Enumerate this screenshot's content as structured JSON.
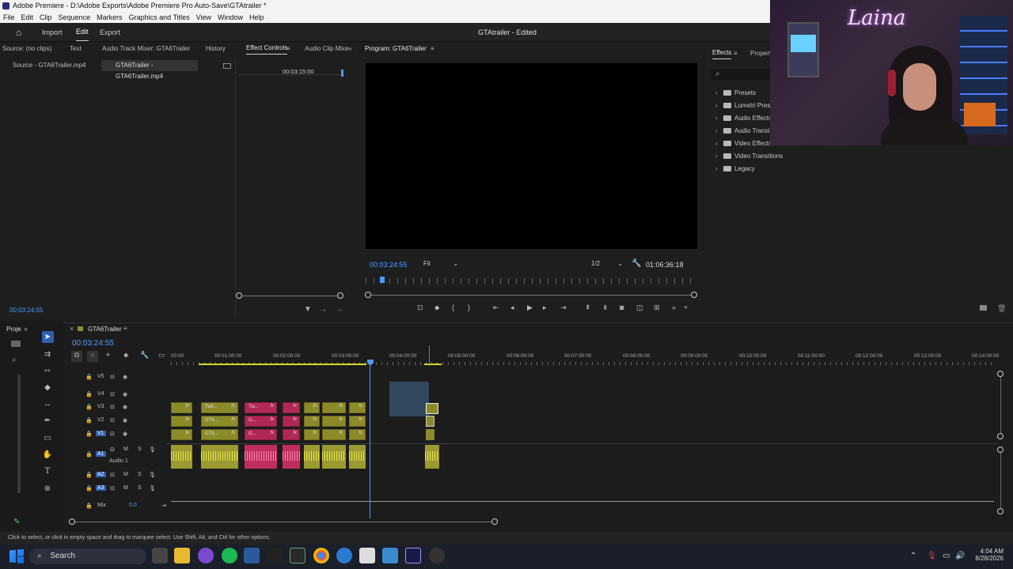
{
  "window": {
    "title": "Adobe Premiere - D:\\Adobe Exports\\Adobe Premiere Pro Auto-Save\\GTAtrailer *"
  },
  "menu": [
    "File",
    "Edit",
    "Clip",
    "Sequence",
    "Markers",
    "Graphics and Titles",
    "View",
    "Window",
    "Help"
  ],
  "workspace": {
    "import": "Import",
    "edit": "Edit",
    "export": "Export",
    "project_title": "GTAtrailer - Edited"
  },
  "source_panel": {
    "tabs": [
      "Source: (no clips)",
      "Text",
      "Audio Track Mixer: GTA6Trailer",
      "History",
      "Effect Controls",
      "Audio Clip Mixe"
    ],
    "subtabs": [
      "Source - GTA6Trailer.mp4",
      "GTA6Trailer - GTA6Trailer.mp4"
    ],
    "ruler_time": "00:03:15:00",
    "timecode": "00:03:24:55"
  },
  "program": {
    "tab": "Program: GTA6Trailer",
    "timecode": "00:03:24:55",
    "fit": "Fit",
    "resolution": "1/2",
    "duration": "01:06:36:18"
  },
  "effects": {
    "tabs": [
      "Effects",
      "Propert"
    ],
    "items": [
      "Presets",
      "Lumetri Prese",
      "Audio Effects",
      "Audio Transit",
      "Video Effects",
      "Video Transitions",
      "Legacy"
    ]
  },
  "webcam": {
    "sign": "Laina"
  },
  "timeline": {
    "project_tab": "Proje",
    "sequence_tab": "GTA6Trailer",
    "timecode": "00:03:24:55",
    "ruler": [
      "00:00",
      "00:01:00:00",
      "00:02:00:00",
      "00:03:00:00",
      "00:04:00:00",
      "00:05:00:00",
      "00:06:00:00",
      "00:07:00:00",
      "00:08:00:00",
      "00:09:00:00",
      "00:10:00:00",
      "00:11:00:00",
      "00:12:00:00",
      "00:13:00:00",
      "00:14:00:00"
    ],
    "video_tracks": [
      "V5",
      "V4",
      "V3",
      "V2",
      "V1"
    ],
    "audio_tracks": [
      "A1",
      "A2",
      "A3"
    ],
    "audio1_name": "Audio 1",
    "mix_label": "Mix",
    "mix_value": "0.0",
    "clip_labels": [
      "Twit...",
      "Tw...",
      "GTA...",
      "G...",
      "GTA...",
      "G..."
    ],
    "fx": "fx"
  },
  "status_bar": "Click to select, or click in empty space and drag to marquee select. Use Shift, Alt, and Ctrl for other options.",
  "taskbar": {
    "search": "Search",
    "time": "4:04 AM",
    "date": "8/28/2026"
  },
  "colors": {
    "accent_blue": "#4e9bff",
    "video_clip": "#8b8b2a",
    "pink_clip": "#b02856",
    "playhead": "#4e9bff"
  }
}
